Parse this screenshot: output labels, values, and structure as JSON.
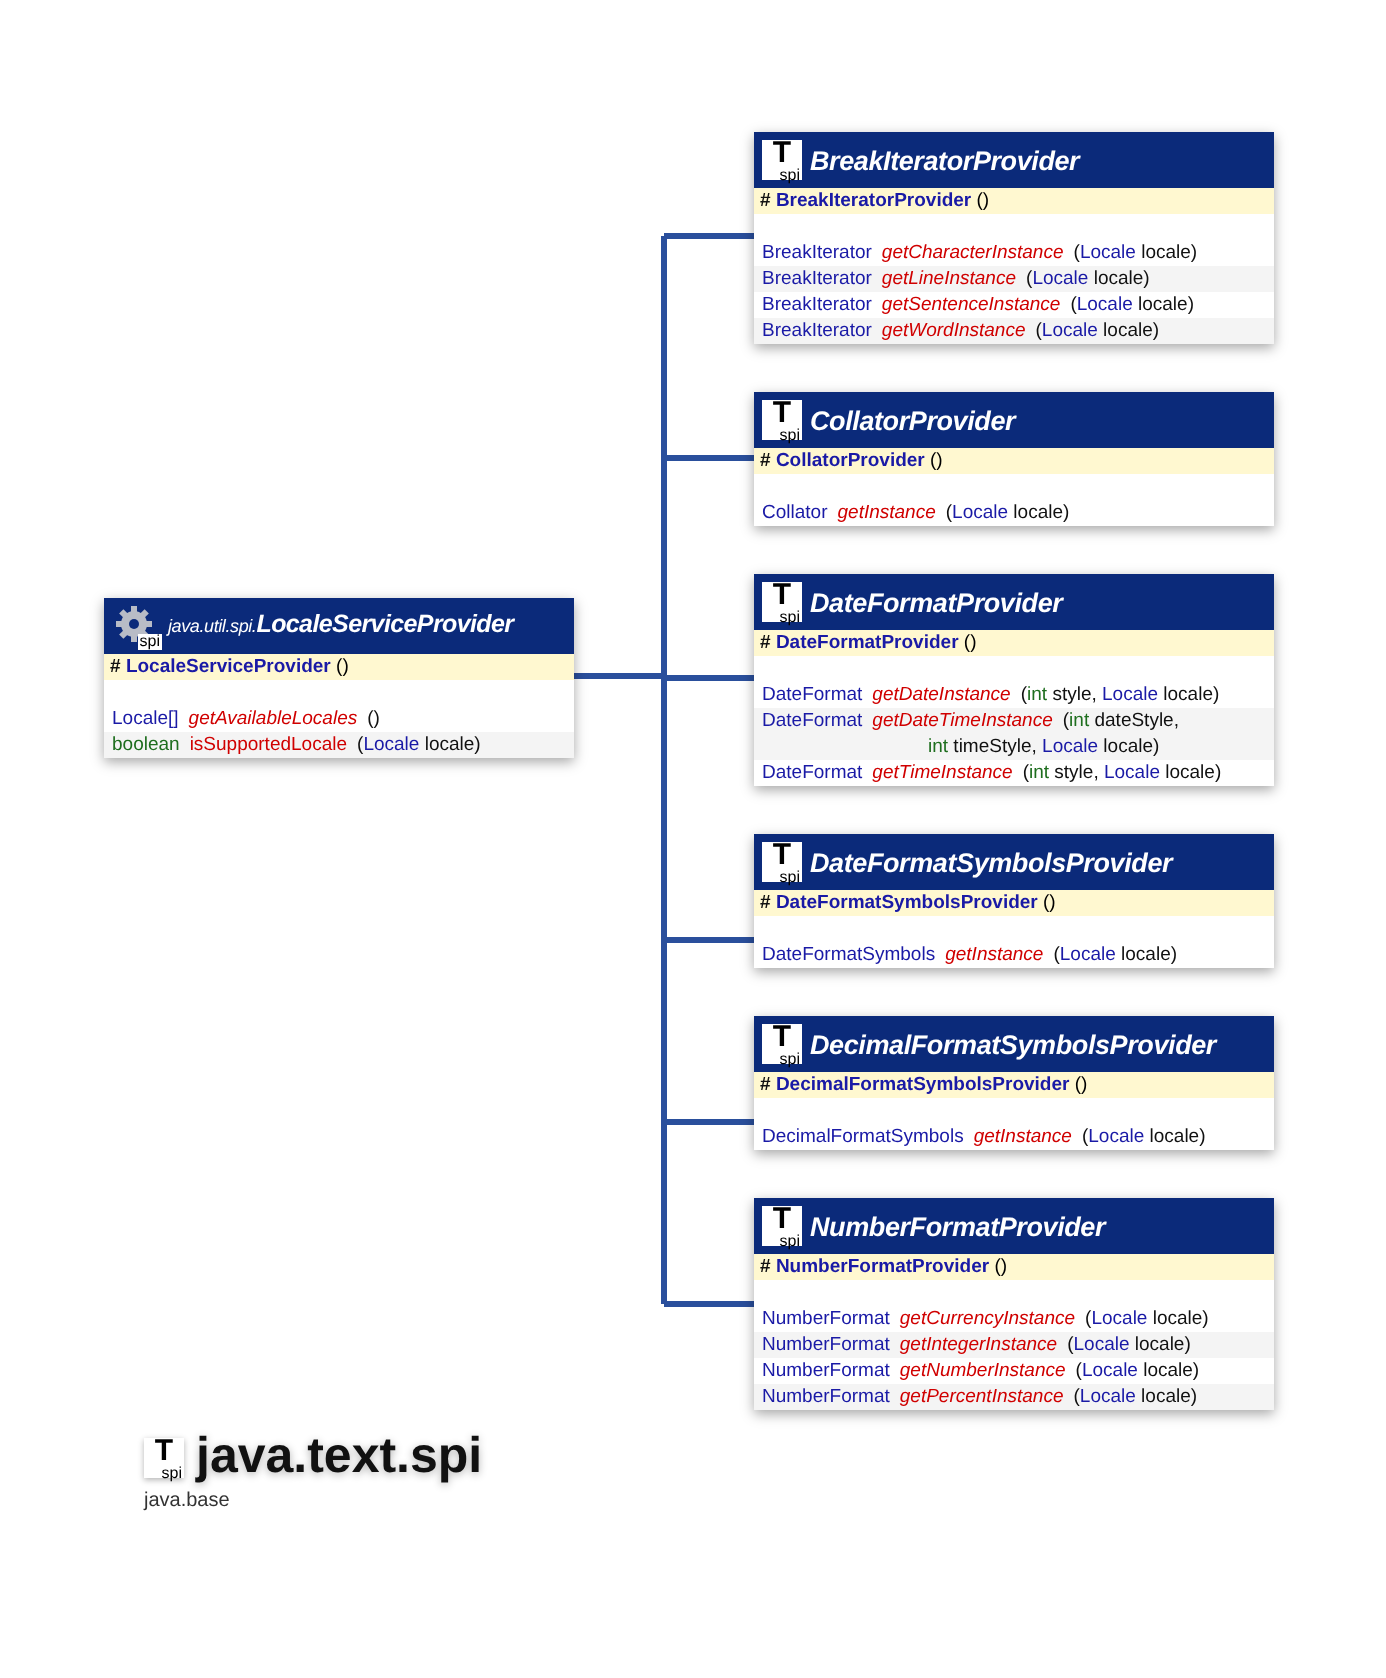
{
  "superclass": {
    "kind": "class",
    "badge": "spi",
    "package": "java.util.spi.",
    "name": "LocaleServiceProvider",
    "constructor": {
      "visibility": "#",
      "name": "LocaleServiceProvider",
      "signature": "()"
    },
    "methods": [
      {
        "return": {
          "kind": "class",
          "text": "Locale[]"
        },
        "name": "getAvailableLocales",
        "abstract": true,
        "params": [
          {
            "kind": "plain",
            "text": "()"
          }
        ]
      },
      {
        "return": {
          "kind": "primitive",
          "text": "boolean"
        },
        "name": "isSupportedLocale",
        "abstract": false,
        "params": [
          {
            "kind": "plain",
            "text": "("
          },
          {
            "kind": "class",
            "text": "Locale"
          },
          {
            "kind": "plain",
            "text": " locale)"
          }
        ]
      }
    ]
  },
  "subclasses": [
    {
      "kind": "interface",
      "badge_glyph": "T",
      "badge": "spi",
      "name": "BreakIteratorProvider",
      "constructor": {
        "visibility": "#",
        "name": "BreakIteratorProvider",
        "signature": "()"
      },
      "methods": [
        {
          "return": {
            "kind": "class",
            "text": "BreakIterator"
          },
          "name": "getCharacterInstance",
          "abstract": true,
          "params": [
            {
              "kind": "plain",
              "text": "("
            },
            {
              "kind": "class",
              "text": "Locale"
            },
            {
              "kind": "plain",
              "text": " locale)"
            }
          ]
        },
        {
          "return": {
            "kind": "class",
            "text": "BreakIterator"
          },
          "name": "getLineInstance",
          "abstract": true,
          "params": [
            {
              "kind": "plain",
              "text": "("
            },
            {
              "kind": "class",
              "text": "Locale"
            },
            {
              "kind": "plain",
              "text": " locale)"
            }
          ]
        },
        {
          "return": {
            "kind": "class",
            "text": "BreakIterator"
          },
          "name": "getSentenceInstance",
          "abstract": true,
          "params": [
            {
              "kind": "plain",
              "text": "("
            },
            {
              "kind": "class",
              "text": "Locale"
            },
            {
              "kind": "plain",
              "text": " locale)"
            }
          ]
        },
        {
          "return": {
            "kind": "class",
            "text": "BreakIterator"
          },
          "name": "getWordInstance",
          "abstract": true,
          "params": [
            {
              "kind": "plain",
              "text": "("
            },
            {
              "kind": "class",
              "text": "Locale"
            },
            {
              "kind": "plain",
              "text": " locale)"
            }
          ]
        }
      ]
    },
    {
      "kind": "interface",
      "badge_glyph": "T",
      "badge": "spi",
      "name": "CollatorProvider",
      "constructor": {
        "visibility": "#",
        "name": "CollatorProvider",
        "signature": "()"
      },
      "methods": [
        {
          "return": {
            "kind": "class",
            "text": "Collator"
          },
          "name": "getInstance",
          "abstract": true,
          "params": [
            {
              "kind": "plain",
              "text": "("
            },
            {
              "kind": "class",
              "text": "Locale"
            },
            {
              "kind": "plain",
              "text": " locale)"
            }
          ]
        }
      ]
    },
    {
      "kind": "interface",
      "badge_glyph": "T",
      "badge": "spi",
      "name": "DateFormatProvider",
      "constructor": {
        "visibility": "#",
        "name": "DateFormatProvider",
        "signature": "()"
      },
      "methods": [
        {
          "return": {
            "kind": "class",
            "text": "DateFormat"
          },
          "name": "getDateInstance",
          "abstract": true,
          "params": [
            {
              "kind": "plain",
              "text": "("
            },
            {
              "kind": "primitive",
              "text": "int"
            },
            {
              "kind": "plain",
              "text": " style, "
            },
            {
              "kind": "class",
              "text": "Locale"
            },
            {
              "kind": "plain",
              "text": " locale)"
            }
          ]
        },
        {
          "return": {
            "kind": "class",
            "text": "DateFormat"
          },
          "name": "getDateTimeInstance",
          "abstract": true,
          "params": [
            {
              "kind": "plain",
              "text": "("
            },
            {
              "kind": "primitive",
              "text": "int"
            },
            {
              "kind": "plain",
              "text": " dateStyle, "
            },
            {
              "kind": "primitive",
              "text": "int"
            },
            {
              "kind": "plain",
              "text": " timeStyle, "
            },
            {
              "kind": "class",
              "text": "Locale"
            },
            {
              "kind": "plain",
              "text": " locale)"
            }
          ]
        },
        {
          "return": {
            "kind": "class",
            "text": "DateFormat"
          },
          "name": "getTimeInstance",
          "abstract": true,
          "params": [
            {
              "kind": "plain",
              "text": "("
            },
            {
              "kind": "primitive",
              "text": "int"
            },
            {
              "kind": "plain",
              "text": " style, "
            },
            {
              "kind": "class",
              "text": "Locale"
            },
            {
              "kind": "plain",
              "text": " locale)"
            }
          ]
        }
      ]
    },
    {
      "kind": "interface",
      "badge_glyph": "T",
      "badge": "spi",
      "name": "DateFormatSymbolsProvider",
      "constructor": {
        "visibility": "#",
        "name": "DateFormatSymbolsProvider",
        "signature": "()"
      },
      "methods": [
        {
          "return": {
            "kind": "class",
            "text": "DateFormatSymbols"
          },
          "name": "getInstance",
          "abstract": true,
          "params": [
            {
              "kind": "plain",
              "text": "("
            },
            {
              "kind": "class",
              "text": "Locale"
            },
            {
              "kind": "plain",
              "text": " locale)"
            }
          ]
        }
      ]
    },
    {
      "kind": "interface",
      "badge_glyph": "T",
      "badge": "spi",
      "name": "DecimalFormatSymbolsProvider",
      "constructor": {
        "visibility": "#",
        "name": "DecimalFormatSymbolsProvider",
        "signature": "()"
      },
      "methods": [
        {
          "return": {
            "kind": "class",
            "text": "DecimalFormatSymbols"
          },
          "name": "getInstance",
          "abstract": true,
          "params": [
            {
              "kind": "plain",
              "text": "("
            },
            {
              "kind": "class",
              "text": "Locale"
            },
            {
              "kind": "plain",
              "text": " locale)"
            }
          ]
        }
      ]
    },
    {
      "kind": "interface",
      "badge_glyph": "T",
      "badge": "spi",
      "name": "NumberFormatProvider",
      "constructor": {
        "visibility": "#",
        "name": "NumberFormatProvider",
        "signature": "()"
      },
      "methods": [
        {
          "return": {
            "kind": "class",
            "text": "NumberFormat"
          },
          "name": "getCurrencyInstance",
          "abstract": true,
          "params": [
            {
              "kind": "plain",
              "text": "("
            },
            {
              "kind": "class",
              "text": "Locale"
            },
            {
              "kind": "plain",
              "text": " locale)"
            }
          ]
        },
        {
          "return": {
            "kind": "class",
            "text": "NumberFormat"
          },
          "name": "getIntegerInstance",
          "abstract": true,
          "params": [
            {
              "kind": "plain",
              "text": "("
            },
            {
              "kind": "class",
              "text": "Locale"
            },
            {
              "kind": "plain",
              "text": " locale)"
            }
          ]
        },
        {
          "return": {
            "kind": "class",
            "text": "NumberFormat"
          },
          "name": "getNumberInstance",
          "abstract": true,
          "params": [
            {
              "kind": "plain",
              "text": "("
            },
            {
              "kind": "class",
              "text": "Locale"
            },
            {
              "kind": "plain",
              "text": " locale)"
            }
          ]
        },
        {
          "return": {
            "kind": "class",
            "text": "NumberFormat"
          },
          "name": "getPercentInstance",
          "abstract": true,
          "params": [
            {
              "kind": "plain",
              "text": "("
            },
            {
              "kind": "class",
              "text": "Locale"
            },
            {
              "kind": "plain",
              "text": " locale)"
            }
          ]
        }
      ]
    }
  ],
  "package": {
    "badge_glyph": "T",
    "badge": "spi",
    "name": "java.text.spi",
    "module": "java.base"
  }
}
